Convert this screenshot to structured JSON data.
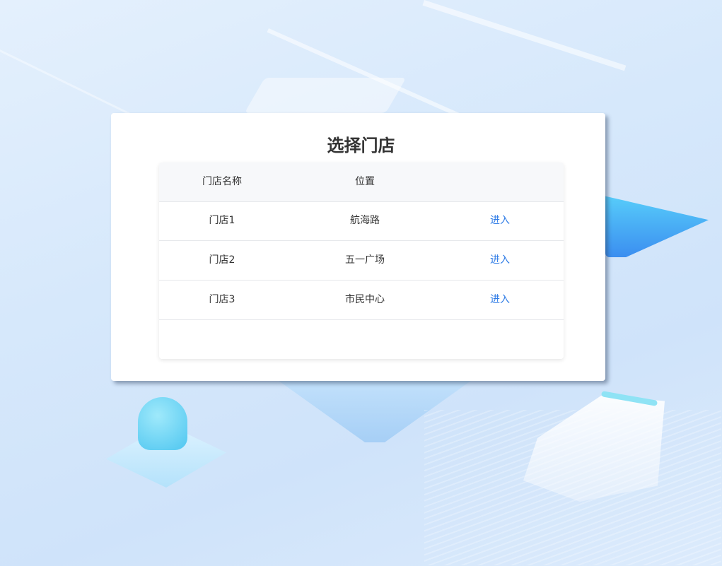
{
  "title": "选择门店",
  "table": {
    "headers": [
      "门店名称",
      "位置",
      ""
    ],
    "rows": [
      {
        "name": "门店1",
        "location": "航海路",
        "action": "进入"
      },
      {
        "name": "门店2",
        "location": "五一广场",
        "action": "进入"
      },
      {
        "name": "门店3",
        "location": "市民中心",
        "action": "进入"
      }
    ]
  },
  "colors": {
    "link": "#2f7ce6",
    "text": "#333333",
    "header_bg": "#f7f8fa"
  }
}
